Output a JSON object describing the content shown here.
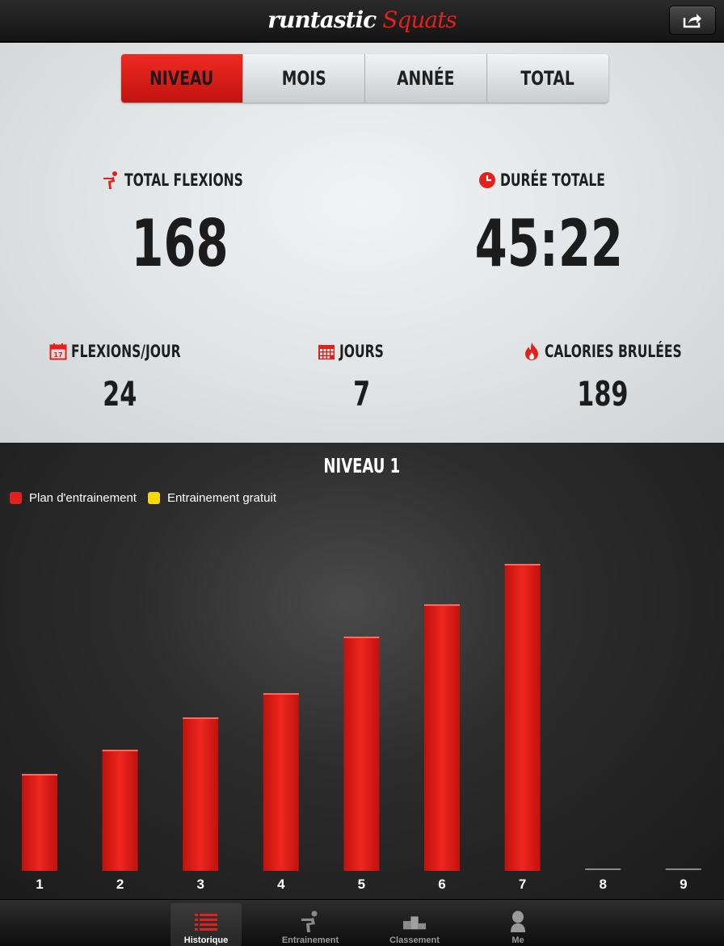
{
  "header": {
    "logo_main": "runtastic",
    "logo_sub": "Squats",
    "share_icon": "share-icon"
  },
  "tabs": [
    {
      "label": "NIVEAU",
      "active": true
    },
    {
      "label": "MOIS",
      "active": false
    },
    {
      "label": "ANNÉE",
      "active": false
    },
    {
      "label": "TOTAL",
      "active": false
    }
  ],
  "stats": {
    "total_flexions": {
      "label": "TOTAL FLEXIONS",
      "value": "168",
      "icon": "squat-figure-icon"
    },
    "duree_totale": {
      "label": "DURÉE TOTALE",
      "value": "45:22",
      "icon": "clock-icon"
    },
    "flexions_jour": {
      "label": "FLEXIONS/JOUR",
      "value": "24",
      "icon": "calendar-day-icon"
    },
    "jours": {
      "label": "JOURS",
      "value": "7",
      "icon": "calendar-grid-icon"
    },
    "calories": {
      "label": "CALORIES BRULÉES",
      "value": "189",
      "icon": "flame-icon"
    }
  },
  "colors": {
    "accent": "#e3211c",
    "plan": "#e3211c",
    "free": "#f5d800"
  },
  "chart_data": {
    "type": "bar",
    "title": "NIVEAU 1",
    "categories": [
      "1",
      "2",
      "3",
      "4",
      "5",
      "6",
      "7",
      "8",
      "9"
    ],
    "series": [
      {
        "name": "Plan d'entrainement",
        "color": "#e3211c",
        "values": [
          12,
          15,
          19,
          22,
          29,
          33,
          38,
          0,
          0
        ]
      },
      {
        "name": "Entrainement gratuit",
        "color": "#f5d800",
        "values": [
          0,
          0,
          0,
          0,
          0,
          0,
          0,
          0,
          0
        ]
      }
    ],
    "legend_position": "top-left",
    "grid": false,
    "ylim": [
      0,
      40
    ]
  },
  "tabbar": [
    {
      "label": "Historique",
      "icon": "list-icon",
      "active": true
    },
    {
      "label": "Entrainement",
      "icon": "squat-figure-icon",
      "active": false
    },
    {
      "label": "Classement",
      "icon": "podium-icon",
      "active": false
    },
    {
      "label": "Me",
      "icon": "person-icon",
      "active": false
    }
  ]
}
